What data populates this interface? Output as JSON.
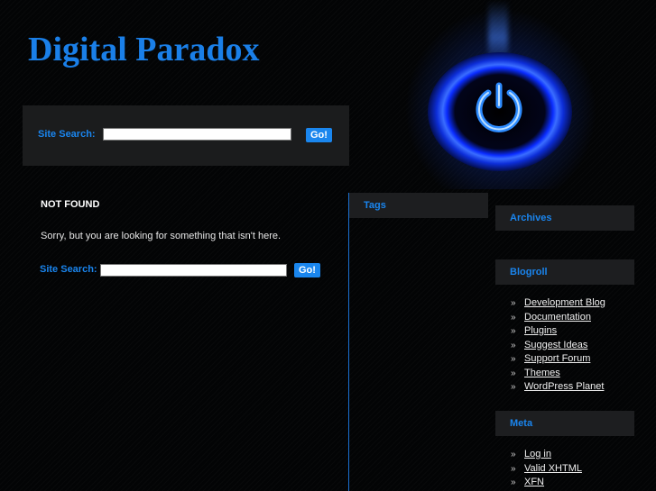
{
  "header": {
    "site_title": "Digital Paradox",
    "search": {
      "label": "Site Search:",
      "value": "",
      "placeholder": "",
      "button": "Go!"
    }
  },
  "content": {
    "title": "NOT FOUND",
    "message": "Sorry, but you are looking for something that isn't here.",
    "search": {
      "label": "Site Search:",
      "value": "",
      "placeholder": "",
      "button": "Go!"
    }
  },
  "sidebar": {
    "tags": {
      "title": "Tags"
    },
    "archives": {
      "title": "Archives"
    },
    "blogroll": {
      "title": "Blogroll",
      "links": [
        "Development Blog",
        "Documentation",
        "Plugins",
        "Suggest Ideas",
        "Support Forum",
        "Themes",
        "WordPress Planet"
      ]
    },
    "meta": {
      "title": "Meta",
      "links": [
        "Log in",
        "Valid XHTML",
        "XFN"
      ]
    }
  },
  "theme": {
    "accent": "#1a85ee",
    "panel": "#1d1e20",
    "background": "#030405"
  },
  "icons": {
    "header_graphic": "power-icon",
    "list_bullet": "double-chevron-right-icon"
  }
}
